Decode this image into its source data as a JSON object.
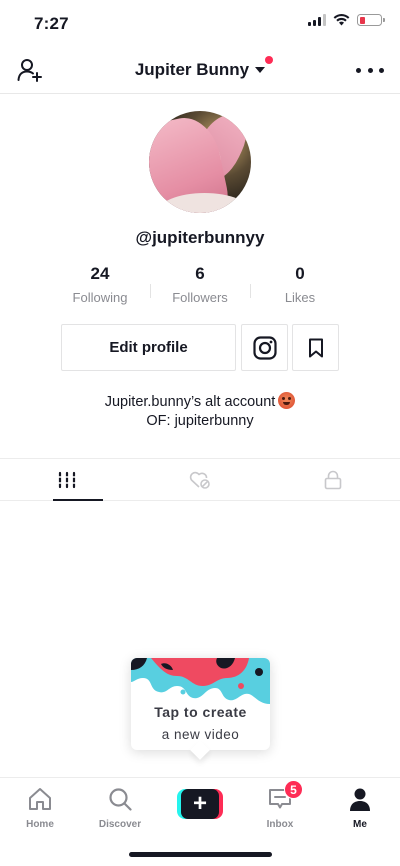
{
  "status_bar": {
    "time": "7:27",
    "battery_color": "#e8364b"
  },
  "header": {
    "account_name": "Jupiter Bunny",
    "has_notification": true
  },
  "profile": {
    "username": "@jupiterbunnyy",
    "stats": [
      {
        "value": "24",
        "label": "Following"
      },
      {
        "value": "6",
        "label": "Followers"
      },
      {
        "value": "0",
        "label": "Likes"
      }
    ],
    "edit_button_label": "Edit profile",
    "bio_line_1": "Jupiter.bunny’s alt account",
    "bio_line_2": "OF: jupiterbunny"
  },
  "tabs": [
    {
      "icon": "grid-icon",
      "active": true
    },
    {
      "icon": "liked-hidden-icon",
      "active": false
    },
    {
      "icon": "lock-icon",
      "active": false
    }
  ],
  "create_card": {
    "title": "Tap to create",
    "subtitle": "a new video"
  },
  "bottom_nav": {
    "items": [
      {
        "label": "Home",
        "icon": "home-icon"
      },
      {
        "label": "Discover",
        "icon": "search-icon"
      },
      {
        "label": "",
        "icon": "plus-icon"
      },
      {
        "label": "Inbox",
        "icon": "inbox-icon"
      },
      {
        "label": "Me",
        "icon": "person-icon"
      }
    ],
    "inbox_badge": "5"
  },
  "colors": {
    "accent_red": "#fe2c55",
    "accent_cyan": "#25f4ee",
    "text": "#161823",
    "muted": "#8a8b91"
  }
}
